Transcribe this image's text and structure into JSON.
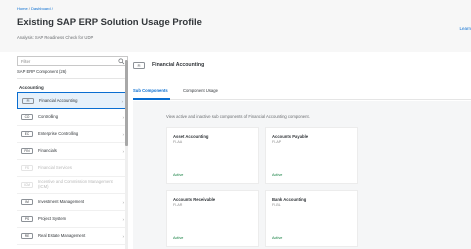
{
  "header": {
    "breadcrumb_home": "Home",
    "breadcrumb_separator": " / ",
    "breadcrumb_current": "Dashboard /",
    "title": "Existing SAP ERP Solution Usage Profile",
    "subtitle": "Analysis: SAP Readiness Check for UDP",
    "learn_label": "Learn"
  },
  "sidebar": {
    "filter_placeholder": "Filter",
    "component_count": "SAP ERP Component (26)",
    "group_title": "Accounting",
    "items": [
      {
        "tag": "FI",
        "label": "Financial Accounting",
        "state": "selected"
      },
      {
        "tag": "CO",
        "label": "Controlling",
        "state": "normal"
      },
      {
        "tag": "EC",
        "label": "Enterprise Controlling",
        "state": "normal"
      },
      {
        "tag": "FIN",
        "label": "Financials",
        "state": "normal"
      },
      {
        "tag": "FS",
        "label": "Financial Services",
        "state": "disabled"
      },
      {
        "tag": "ICM",
        "label": "Incentive and Commission Management (ICM)",
        "state": "disabled"
      },
      {
        "tag": "IM",
        "label": "Investment Management",
        "state": "normal"
      },
      {
        "tag": "PS",
        "label": "Project System",
        "state": "normal"
      },
      {
        "tag": "RE",
        "label": "Real Estate Management",
        "state": "normal"
      }
    ]
  },
  "detail": {
    "tag": "FI",
    "title": "Financial Accounting",
    "tabs": [
      {
        "label": "Sub Components",
        "active": true
      },
      {
        "label": "Component Usage",
        "active": false
      }
    ],
    "intro": "View active and inactive sub components of Financial Accounting component.",
    "cards": [
      {
        "title": "Asset Accounting",
        "code": "FI-AA",
        "status": "Active"
      },
      {
        "title": "Accounts Payable",
        "code": "FI-AP",
        "status": "Active"
      },
      {
        "title": "Accounts Receivable",
        "code": "FI-AR",
        "status": "Active"
      },
      {
        "title": "Bank Accounting",
        "code": "FI-BL",
        "status": "Active"
      }
    ]
  },
  "colors": {
    "accent": "#0a6ed1",
    "active_status": "#107e3e",
    "selected_background": "#e6f1fb"
  },
  "icons": {
    "filter": "search-icon",
    "list_item": "chevron-right-icon"
  }
}
